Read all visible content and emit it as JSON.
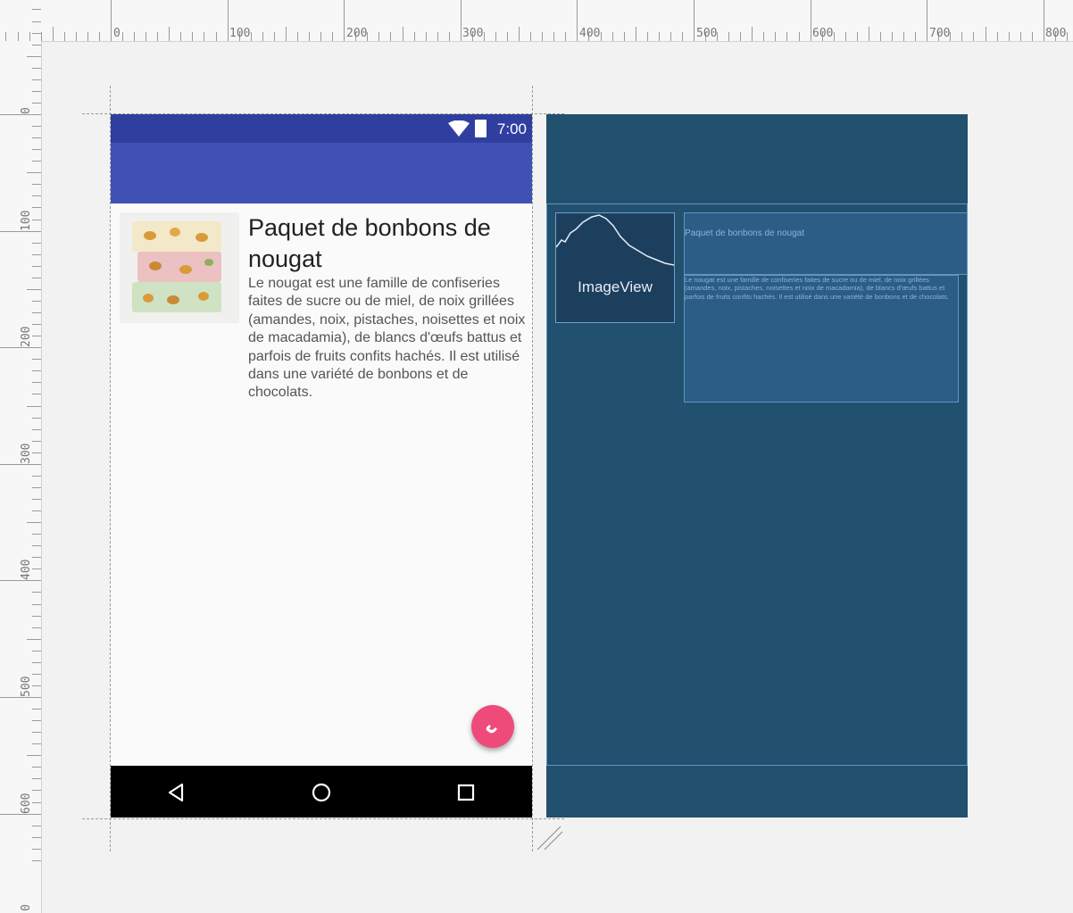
{
  "ruler": {
    "top_labels": [
      "0",
      "100",
      "200",
      "300",
      "400",
      "500",
      "600",
      "700",
      "800"
    ],
    "left_labels": [
      "0",
      "100",
      "200",
      "300",
      "400",
      "500",
      "600",
      "0"
    ]
  },
  "device": {
    "status_bar": {
      "time": "7:00",
      "color": "#303f9f"
    },
    "app_bar": {
      "color": "#3f51b5"
    },
    "item": {
      "title": "Paquet de bonbons de nougat",
      "body": "Le nougat est une famille de confiseries faites de sucre ou de miel, de noix grillées (amandes, noix, pistaches, noisettes et noix de macadamia), de blancs d'œufs battus et parfois de fruits confits hachés. Il est utilisé dans une variété de bonbons et de chocolats."
    },
    "fab": {
      "icon": "phone-icon",
      "color": "#ee4b7b"
    },
    "nav_bar": {
      "icons": [
        "back-icon",
        "home-icon",
        "recents-icon"
      ]
    }
  },
  "blueprint": {
    "image_label": "ImageView",
    "title_text": "Paquet de bonbons de nougat",
    "body_text": "Le nougat est une famille de confiseries faites de sucre ou de miel, de noix grillées (amandes, noix, pistaches, noisettes et noix de macadamia), de blancs d'œufs battus et parfois de fruits confits hachés. Il est utilisé dans une variété de bonbons et de chocolats.",
    "background": "#22506f"
  }
}
